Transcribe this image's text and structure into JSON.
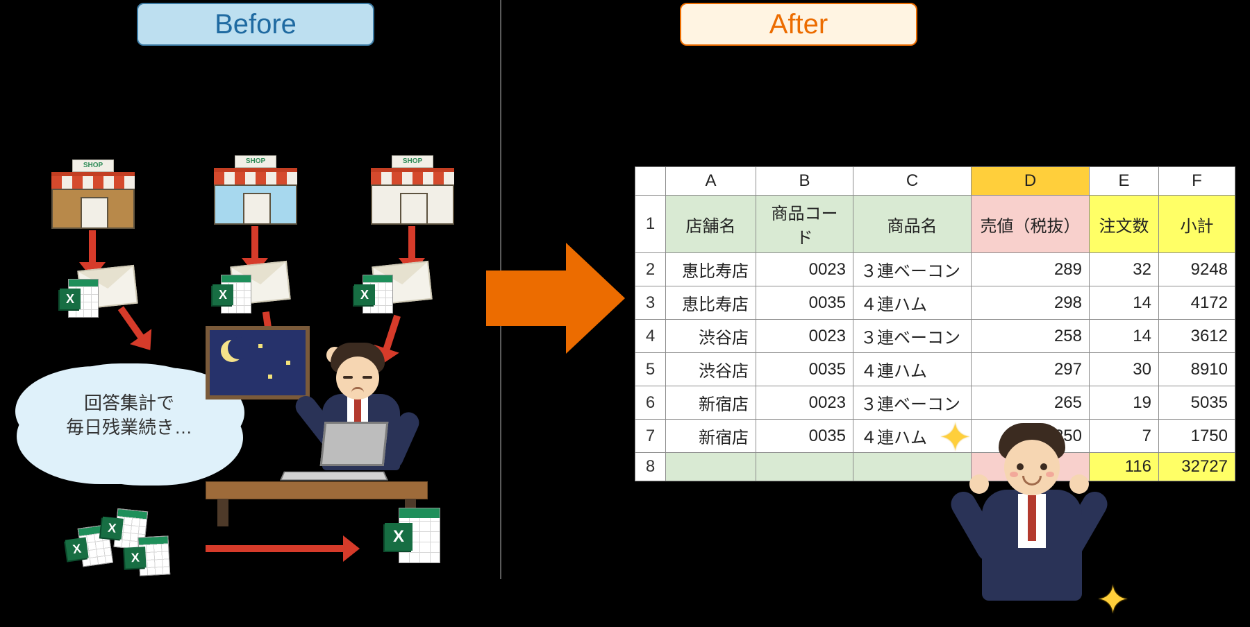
{
  "badges": {
    "before": "Before",
    "after": "After"
  },
  "shop_sign": "SHOP",
  "thought": {
    "line1": "回答集計で",
    "line2": "毎日残業続き…"
  },
  "excel_badge": "X",
  "sparkle": "✦",
  "sheet": {
    "col_letters": [
      "A",
      "B",
      "C",
      "D",
      "E",
      "F"
    ],
    "headers": {
      "A": "店舗名",
      "B": "商品コード",
      "C": "商品名",
      "D": "売値（税抜）",
      "E": "注文数",
      "F": "小計"
    },
    "rows": [
      {
        "n": "2",
        "A": "恵比寿店",
        "B": "0023",
        "C": "３連ベーコン",
        "D": "289",
        "E": "32",
        "F": "9248"
      },
      {
        "n": "3",
        "A": "恵比寿店",
        "B": "0035",
        "C": "４連ハム",
        "D": "298",
        "E": "14",
        "F": "4172"
      },
      {
        "n": "4",
        "A": "渋谷店",
        "B": "0023",
        "C": "３連ベーコン",
        "D": "258",
        "E": "14",
        "F": "3612"
      },
      {
        "n": "5",
        "A": "渋谷店",
        "B": "0035",
        "C": "４連ハム",
        "D": "297",
        "E": "30",
        "F": "8910"
      },
      {
        "n": "6",
        "A": "新宿店",
        "B": "0023",
        "C": "３連ベーコン",
        "D": "265",
        "E": "19",
        "F": "5035"
      },
      {
        "n": "7",
        "A": "新宿店",
        "B": "0035",
        "C": "４連ハム",
        "D": "250",
        "E": "7",
        "F": "1750"
      }
    ],
    "totals": {
      "n": "8",
      "E": "116",
      "F": "32727"
    }
  }
}
